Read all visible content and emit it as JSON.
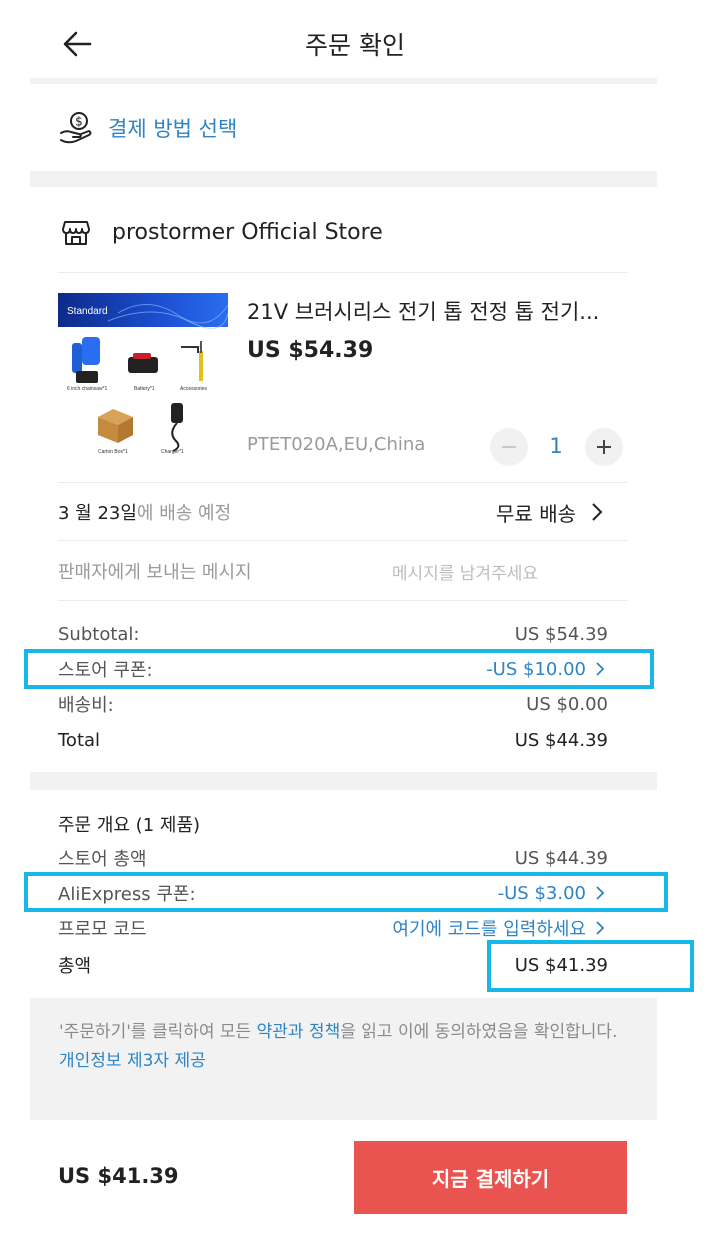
{
  "header": {
    "title": "주문 확인",
    "back_icon": "arrow-left-icon"
  },
  "payment": {
    "label": "결제 방법 선택",
    "icon": "hand-coin-icon"
  },
  "store": {
    "name": "prostormer Official Store",
    "icon": "store-icon"
  },
  "product": {
    "name": "21V 브러시리스 전기 톱 전정 톱 전기...",
    "price": "US $54.39",
    "sku": "PTET020A,EU,China",
    "quantity": "1",
    "image": {
      "banner": "Standard",
      "captions": [
        "6 inch chainsaw*1",
        "Battery*1",
        "Accessories",
        "Carton Box*1",
        "Charger*1"
      ]
    }
  },
  "delivery": {
    "date": "3 월 23일",
    "suffix": "에 배송 예정",
    "shipping": "무료 배송"
  },
  "message": {
    "label": "판매자에게 보내는 메시지",
    "placeholder": "메시지를 남겨주세요"
  },
  "summary": {
    "subtotal_label": "Subtotal:",
    "subtotal_value": "US $54.39",
    "coupon_label": "스토어 쿠폰:",
    "coupon_value": "-US $10.00",
    "shipping_label": "배송비:",
    "shipping_value": "US $0.00",
    "total_label": "Total",
    "total_value": "US $44.39"
  },
  "order": {
    "header": "주문 개요 (1 제품)",
    "store_total_label": "스토어 총액",
    "store_total_value": "US $44.39",
    "ae_coupon_label": "AliExpress 쿠폰:",
    "ae_coupon_value": "-US $3.00",
    "promo_label": "프로모 코드",
    "promo_placeholder": "여기에 코드를 입력하세요",
    "grand_total_label": "총액",
    "grand_total_value": "US $41.39"
  },
  "terms": {
    "pre": "'주문하기'를 클릭하여 모든 ",
    "link": "약관과 정책",
    "post": "을 읽고 이에 동의하였음을 확인합니다.",
    "privacy": "개인정보 제3자 제공"
  },
  "footer": {
    "price": "US $41.39",
    "pay_button": "지금 결제하기"
  },
  "colors": {
    "accent_blue": "#2f84c4",
    "pay_red": "#e95450",
    "highlight": "#17b7ea"
  }
}
